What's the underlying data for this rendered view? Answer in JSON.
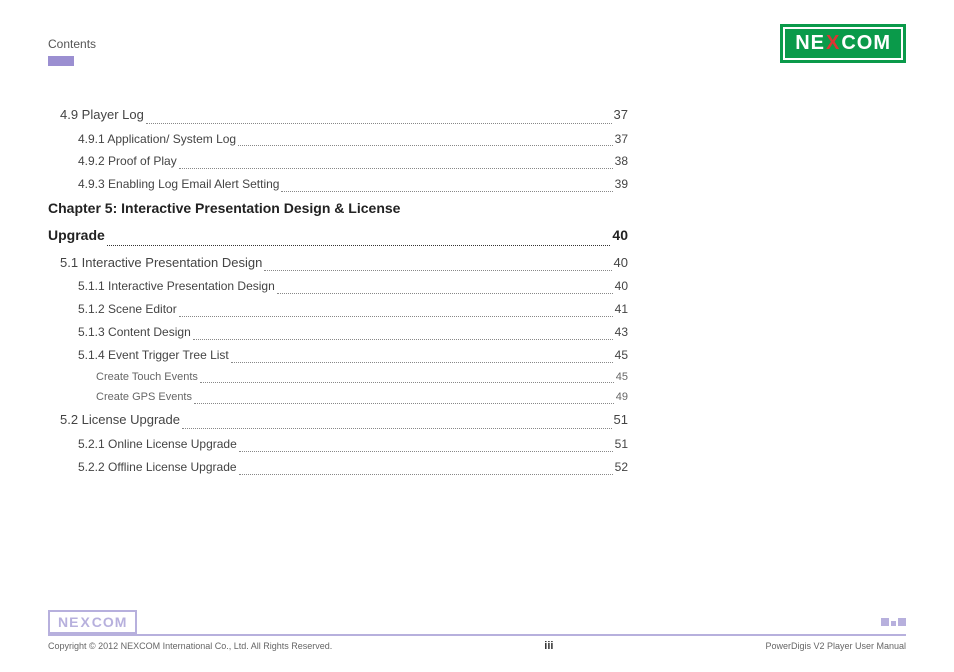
{
  "header": {
    "contents_label": "Contents",
    "logo_left": "NE",
    "logo_x": "X",
    "logo_right": "COM"
  },
  "toc": {
    "s49": {
      "label": "4.9 Player Log",
      "page": "37"
    },
    "s491": {
      "label": "4.9.1 Application/ System Log",
      "page": "37"
    },
    "s492": {
      "label": "4.9.2 Proof of Play",
      "page": "38"
    },
    "s493": {
      "label": "4.9.3 Enabling Log Email Alert Setting",
      "page": "39"
    },
    "ch5_line1": "Chapter 5: Interactive Presentation Design & License",
    "ch5_line2": "Upgrade",
    "ch5_page": "40",
    "s51": {
      "label": "5.1 Interactive Presentation Design",
      "page": "40"
    },
    "s511": {
      "label": "5.1.1 Interactive Presentation Design",
      "page": "40"
    },
    "s512": {
      "label": "5.1.2 Scene Editor",
      "page": "41"
    },
    "s513": {
      "label": "5.1.3 Content Design",
      "page": "43"
    },
    "s514": {
      "label": "5.1.4 Event Trigger Tree List",
      "page": "45"
    },
    "s514a": {
      "label": "Create Touch Events",
      "page": "45"
    },
    "s514b": {
      "label": "Create GPS Events",
      "page": "49"
    },
    "s52": {
      "label": "5.2 License Upgrade",
      "page": "51"
    },
    "s521": {
      "label": "5.2.1 Online License Upgrade",
      "page": "51"
    },
    "s522": {
      "label": "5.2.2 Offline License Upgrade",
      "page": "52"
    }
  },
  "footer": {
    "copyright": "Copyright © 2012 NEXCOM International Co., Ltd. All Rights Reserved.",
    "page": "iii",
    "manual": "PowerDigis V2 Player User Manual",
    "logo_left": "NE",
    "logo_x": "X",
    "logo_right": "COM"
  }
}
